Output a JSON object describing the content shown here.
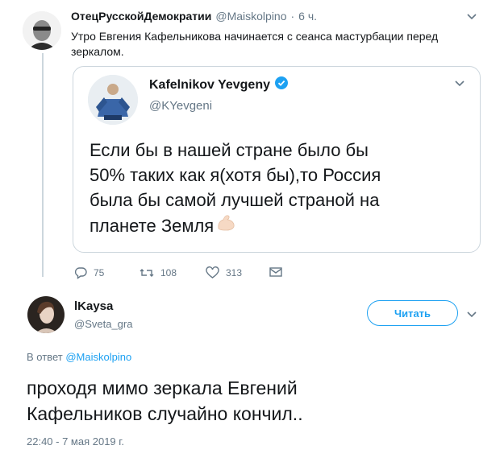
{
  "tweet1": {
    "display_name": "ОтецРусскойДемократии",
    "handle": "@Maiskolpino",
    "separator": "·",
    "time": "6 ч.",
    "text_line1": "Утро Евгения Кафельникова начинается с сеанса мастурбации перед",
    "text_line2": "зеркалом.",
    "actions": {
      "replies": "75",
      "retweets": "108",
      "likes": "313"
    }
  },
  "quoted": {
    "display_name": "Kafelnikov Yevgeny",
    "handle": "@KYevgeni",
    "text_line1": "Если бы в нашей стране было бы",
    "text_line2": "50% таких как я(хотя бы),то Россия",
    "text_line3": "была бы самой лучшей страной на",
    "text_line4": "планете Земля",
    "emoji_icon": "flexed-biceps-emoji"
  },
  "tweet2": {
    "display_name": "lKaysa",
    "handle": "@Sveta_gra",
    "follow_label": "Читать",
    "reply_prefix": "В ответ",
    "reply_handle": "@Maiskolpino",
    "text_line1": "проходя мимо зеркала Евгений",
    "text_line2": "Кафельников случайно кончил..",
    "timestamp": "22:40 - 7 мая 2019 г."
  },
  "colors": {
    "accent": "#1da1f2",
    "muted": "#657786",
    "border": "#ccd6dd",
    "text": "#14171a"
  }
}
